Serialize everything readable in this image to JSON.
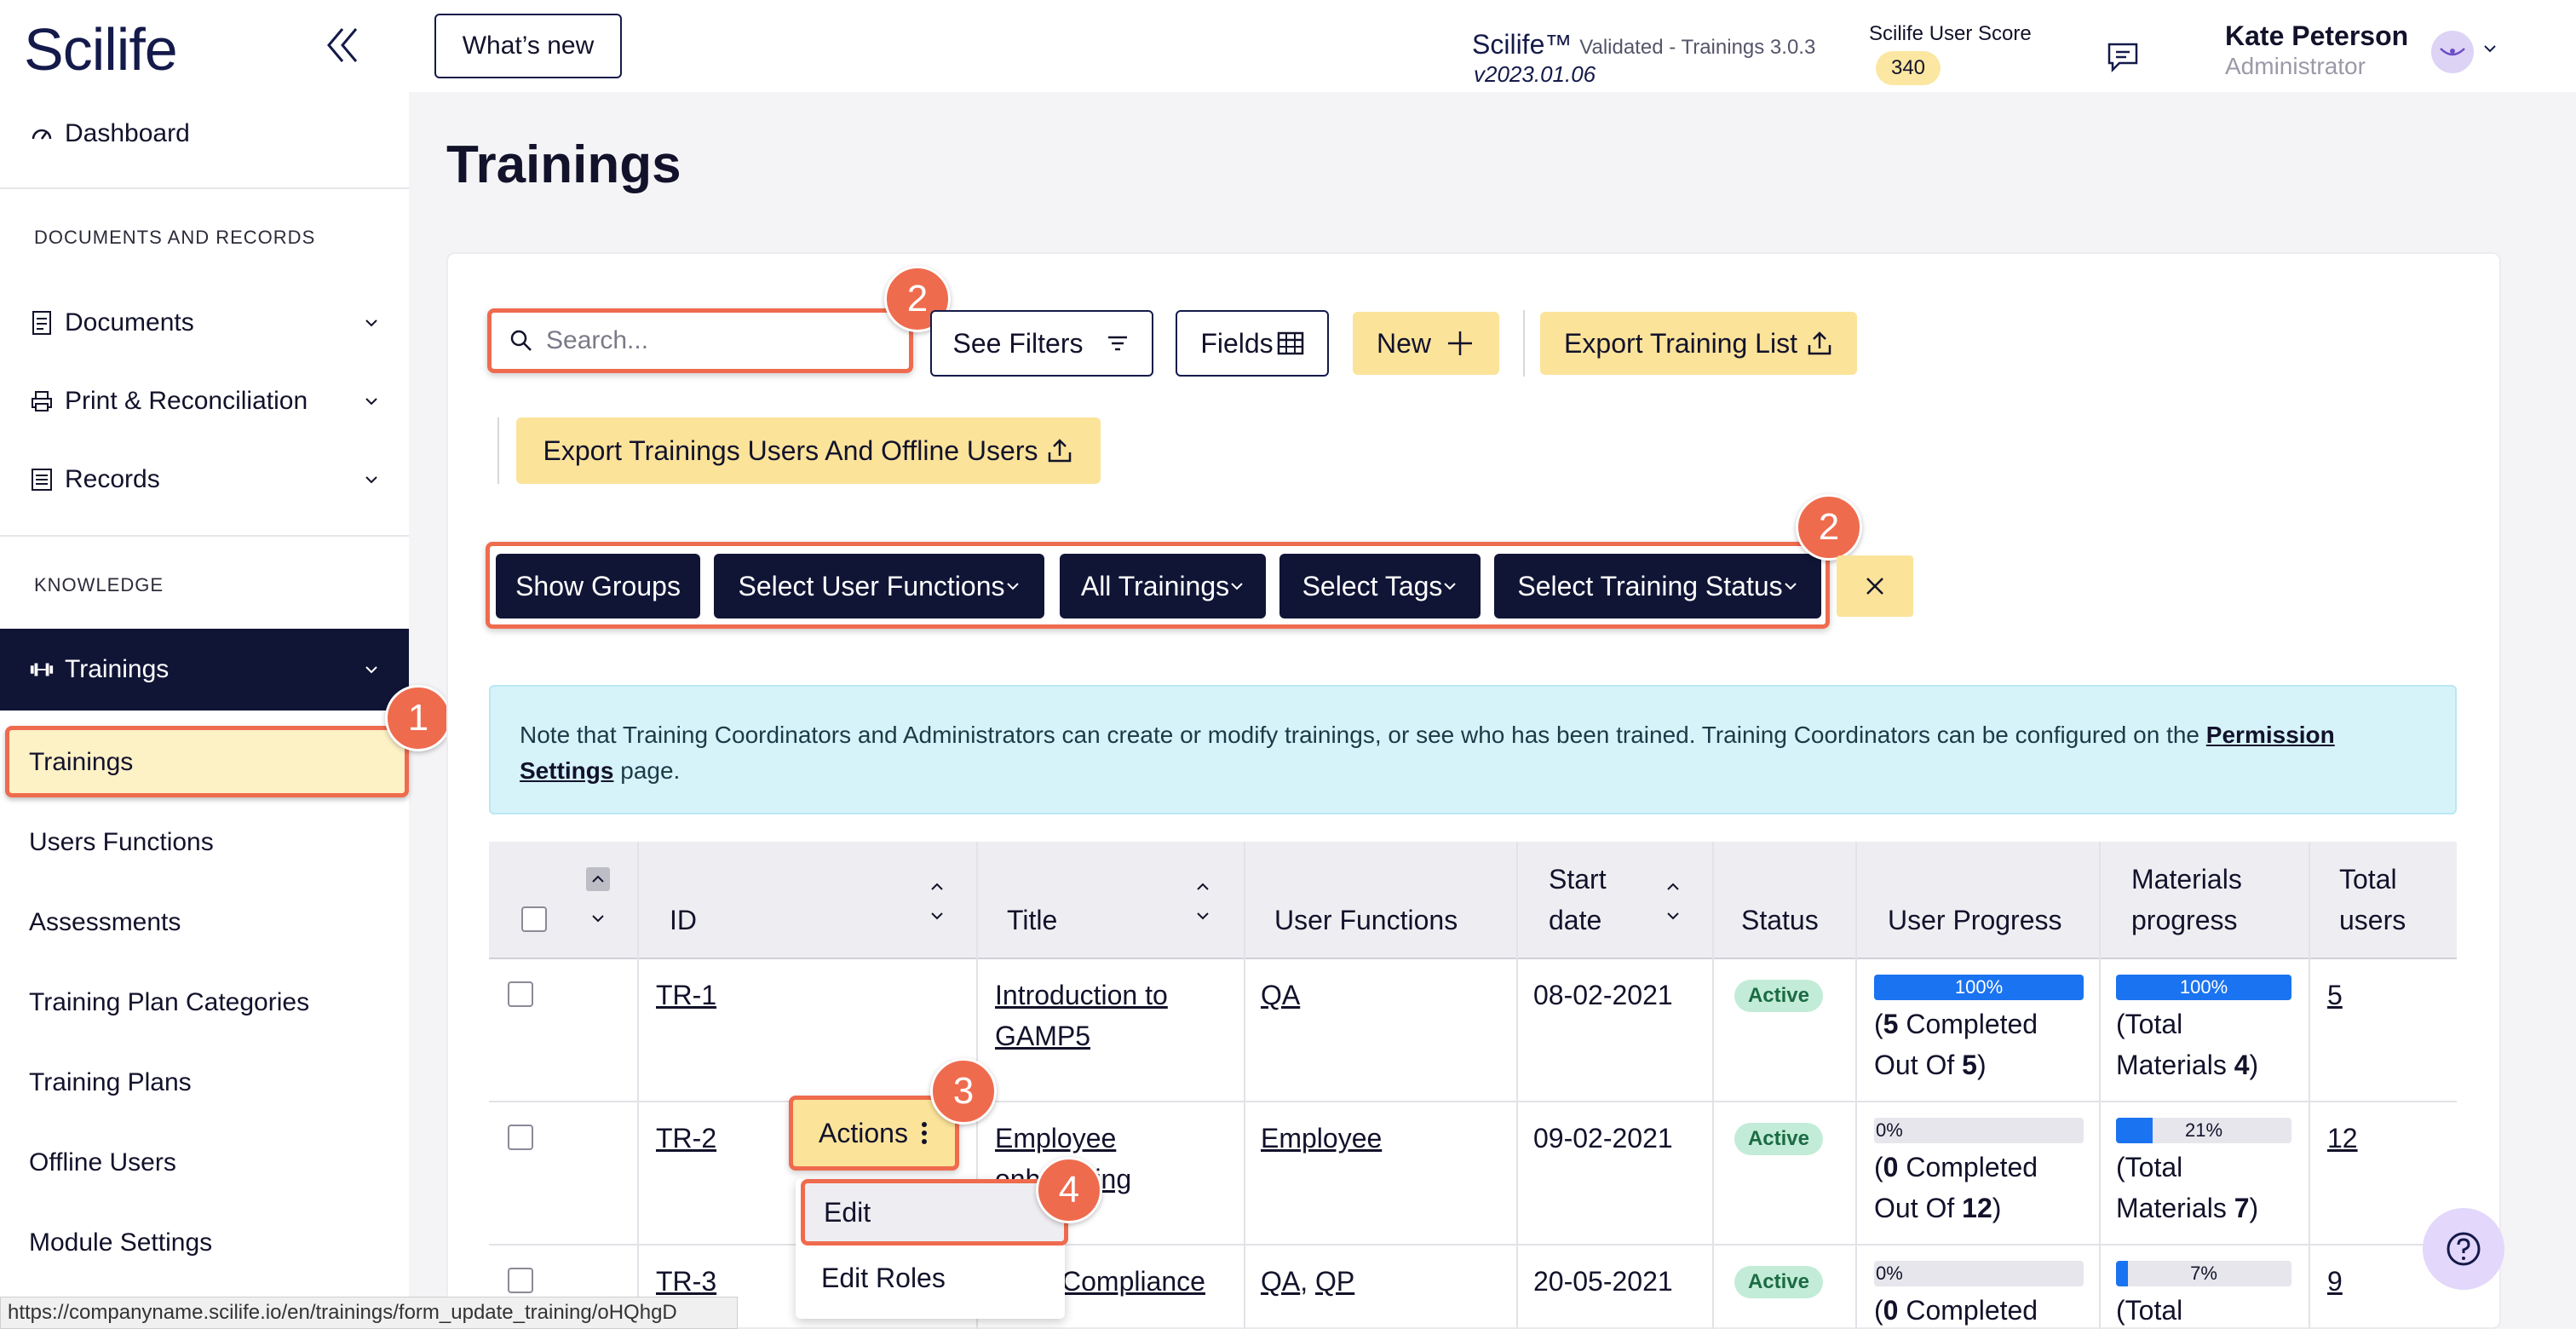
{
  "app": {
    "logo": "Scilife"
  },
  "sidebar": {
    "dashboard": "Dashboard",
    "section_docs": "DOCUMENTS AND RECORDS",
    "documents": "Documents",
    "print": "Print & Reconciliation",
    "records": "Records",
    "section_knowledge": "KNOWLEDGE",
    "trainings_group": "Trainings",
    "sub_items": [
      "Trainings",
      "Users Functions",
      "Assessments",
      "Training Plan Categories",
      "Training Plans",
      "Offline Users",
      "Module Settings"
    ]
  },
  "header": {
    "whats_new": "What’s new",
    "version_main": "Scilife™",
    "version_sub": "Validated - Trainings 3.0.3",
    "version_build": "v2023.01.06",
    "score_label": "Scilife User Score",
    "score_value": "340",
    "user_name": "Kate Peterson",
    "user_role": "Administrator"
  },
  "page": {
    "title": "Trainings"
  },
  "toolbar": {
    "search_placeholder": "Search...",
    "see_filters": "See Filters",
    "fields": "Fields",
    "new": "New",
    "export_list": "Export Training List",
    "export_users": "Export Trainings Users And Offline Users"
  },
  "filters": {
    "show_groups": "Show Groups",
    "user_functions": "Select User Functions",
    "all_trainings": "All Trainings",
    "tags": "Select Tags",
    "status": "Select Training Status"
  },
  "note": {
    "text_before": "Note that Training Coordinators and Administrators can create or modify trainings, or see who has been trained. Training Coordinators can be configured on the ",
    "link": "Permission Settings",
    "text_after": " page."
  },
  "table": {
    "headers": {
      "id": "ID",
      "title": "Title",
      "user_functions": "User Functions",
      "start_date_1": "Start",
      "start_date_2": "date",
      "status": "Status",
      "user_progress": "User Progress",
      "materials_1": "Materials",
      "materials_2": "progress",
      "total_1": "Total",
      "total_2": "users"
    },
    "rows": [
      {
        "id": "TR-1",
        "title_1": "Introduction to",
        "title_2": "GAMP5",
        "functions": "QA",
        "start": "08-02-2021",
        "status": "Active",
        "user_pct_label": "100%",
        "user_pct": 1.0,
        "user_line1_pre": "(",
        "user_completed": "5",
        "user_line1_post": " Completed",
        "user_line2": "Out Of ",
        "user_total": "5",
        "user_line2_post": ")",
        "mat_pct_label": "100%",
        "mat_pct": 1.0,
        "mat_line1": "(Total",
        "mat_line2": "Materials ",
        "mat_total": "4",
        "mat_line2_post": ")",
        "total_users": "5"
      },
      {
        "id": "TR-2",
        "title_1": "Employee",
        "title_2": "onboarding",
        "functions": "Employee",
        "start": "09-02-2021",
        "status": "Active",
        "user_pct_label": "0%",
        "user_pct": 0.0,
        "user_line1_pre": "(",
        "user_completed": "0",
        "user_line1_post": " Completed",
        "user_line2": "Out Of ",
        "user_total": "12",
        "user_line2_post": ")",
        "mat_pct_label": "21%",
        "mat_pct": 0.21,
        "mat_line1": "(Total",
        "mat_line2": "Materials ",
        "mat_total": "7",
        "mat_line2_post": ")",
        "total_users": "12"
      },
      {
        "id": "TR-3",
        "title_1": "Compliance",
        "functions_a": "QA",
        "functions_b": "QP",
        "start": "20-05-2021",
        "status": "Active",
        "user_pct_label": "0%",
        "user_pct": 0.0,
        "user_completed": "0",
        "user_line1_post": " Completed",
        "mat_pct_label": "7%",
        "mat_pct": 0.07,
        "mat_line1": "(Total",
        "total_users": "9"
      }
    ]
  },
  "row_actions": {
    "actions": "Actions",
    "edit": "Edit",
    "edit_roles": "Edit Roles"
  },
  "steps": [
    "1",
    "2",
    "2",
    "3",
    "4"
  ],
  "status_url": "https://companyname.scilife.io/en/trainings/form_update_training/oHQhgD",
  "colors": {
    "navy": "#101536",
    "yellow": "#fbe39a",
    "highlight": "#ef6b4e",
    "progress": "#1a73f0",
    "note_bg": "#d6f3fa"
  }
}
